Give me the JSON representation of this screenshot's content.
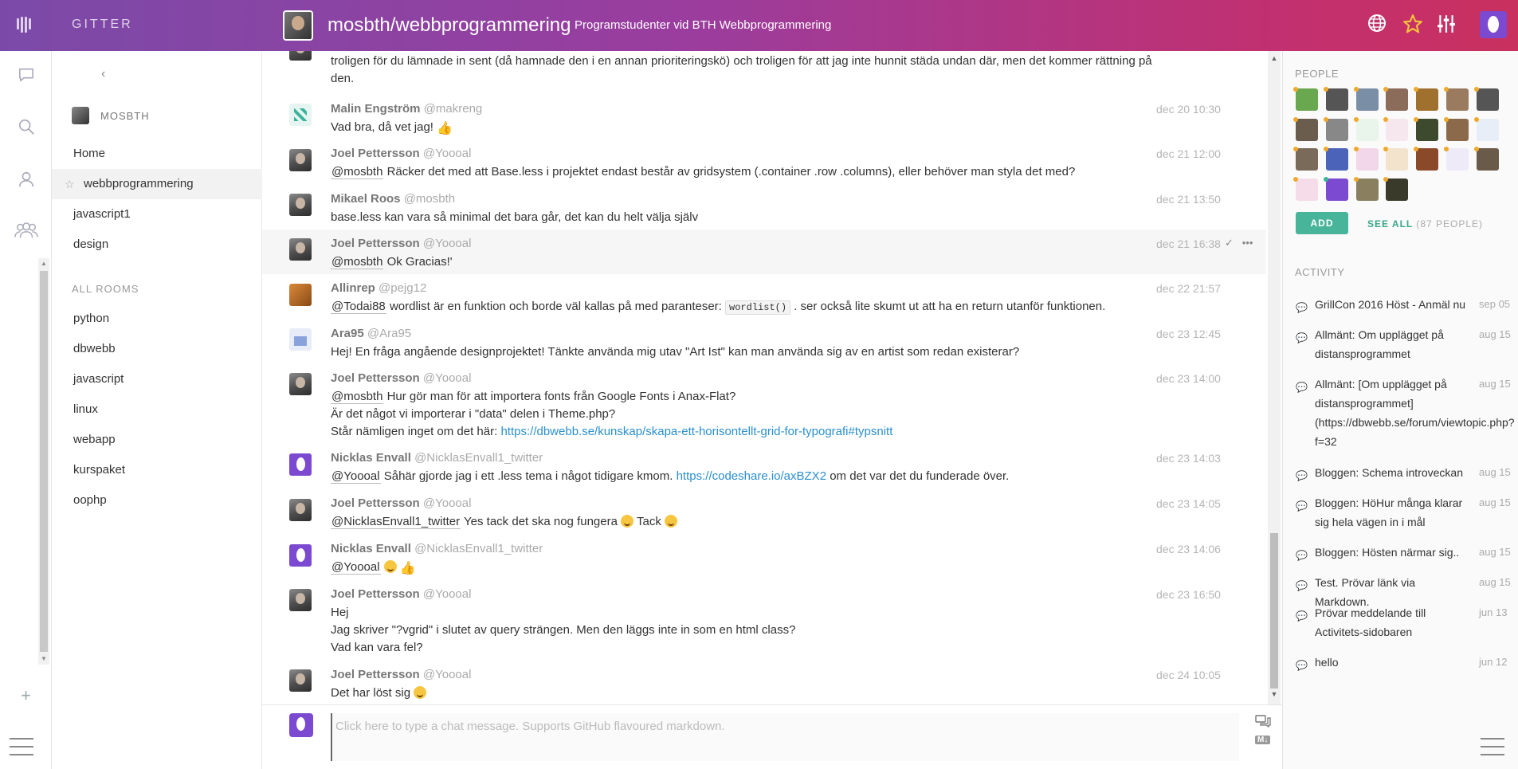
{
  "app": {
    "brand": "GITTER"
  },
  "header": {
    "room_title": "mosbth/webbprogrammering",
    "room_topic": "Programstudenter vid BTH Webbprogrammering",
    "icons": [
      "globe-icon",
      "star-icon",
      "settings-sliders-icon"
    ]
  },
  "roomlist": {
    "org_name": "MOSBTH",
    "items": [
      "Home",
      "webbprogrammering",
      "javascript1",
      "design"
    ],
    "all_rooms_label": "ALL ROOMS",
    "all_rooms": [
      "python",
      "dbwebb",
      "javascript",
      "linux",
      "webapp",
      "kurspaket",
      "oophp"
    ]
  },
  "messages": [
    {
      "name": "",
      "handle": "",
      "time": "",
      "text": "troligen för du lämnade in sent (då hamnade den i en annan prioriteringskö) och troligen för att jag inte hunnit städa undan där, men det kommer rättning på den."
    },
    {
      "name": "Malin Engström",
      "handle": "@makreng",
      "time": "dec 20 10:30",
      "text": "Vad bra, då vet jag!"
    },
    {
      "name": "Joel Pettersson",
      "handle": "@Yoooal",
      "time": "dec 21 12:00",
      "mention": "@mosbth",
      "text": "Räcker det med att Base.less i projektet endast består av gridsystem (.container .row .columns), eller behöver man styla det med?"
    },
    {
      "name": "Mikael Roos",
      "handle": "@mosbth",
      "time": "dec 21 13:50",
      "text": "base.less kan vara så minimal det bara går, det kan du helt välja själv"
    },
    {
      "name": "Joel Pettersson",
      "handle": "@Yoooal",
      "time": "dec 21 16:38",
      "mention": "@mosbth",
      "text": "Ok Gracias!'"
    },
    {
      "name": "Allinrep",
      "handle": "@pejg12",
      "time": "dec 22 21:57",
      "mention": "@Todai88",
      "text_a": "wordlist är en funktion och borde väl kallas på med paranteser:",
      "code": "wordlist()",
      "text_b": ". ser också lite skumt ut att ha en return utanför funktionen."
    },
    {
      "name": "Ara95",
      "handle": "@Ara95",
      "time": "dec 23 12:45",
      "text": "Hej! En fråga angående designprojektet! Tänkte använda mig utav \"Art Ist\" kan man använda sig av en artist som redan existerar?"
    },
    {
      "name": "Joel Pettersson",
      "handle": "@Yoooal",
      "time": "dec 23 14:00",
      "mention": "@mosbth",
      "line1": "Hur gör man för att importera fonts från Google Fonts i Anax-Flat?",
      "line2": "Är det något vi importerar i \"data\" delen i Theme.php?",
      "line3": "Står nämligen inget om det här:",
      "link": "https://dbwebb.se/kunskap/skapa-ett-horisontellt-grid-for-typografi#typsnitt"
    },
    {
      "name": "Nicklas Envall",
      "handle": "@NicklasEnvall1_twitter",
      "time": "dec 23 14:03",
      "mention": "@Yoooal",
      "text_a": "Såhär gjorde jag i ett .less tema i något tidigare kmom.",
      "link": "https://codeshare.io/axBZX2",
      "text_b": "om det var det du funderade över."
    },
    {
      "name": "Joel Pettersson",
      "handle": "@Yoooal",
      "time": "dec 23 14:05",
      "mention": "@NicklasEnvall1_twitter",
      "text_a": "Yes tack det ska nog fungera",
      "text_b": "Tack"
    },
    {
      "name": "Nicklas Envall",
      "handle": "@NicklasEnvall1_twitter",
      "time": "dec 23 14:06",
      "mention": "@Yoooal"
    },
    {
      "name": "Joel Pettersson",
      "handle": "@Yoooal",
      "time": "dec 23 16:50",
      "line1": "Hej",
      "line2": "Jag skriver \"?vgrid\" i slutet av query strängen. Men den läggs inte in som en html class?",
      "line3": "Vad kan vara fel?"
    },
    {
      "name": "Joel Pettersson",
      "handle": "@Yoooal",
      "time": "dec 24 10:05",
      "text": "Det har löst sig"
    }
  ],
  "composer": {
    "placeholder": "Click here to type a chat message. Supports GitHub flavoured markdown.",
    "md_badge": "M↓"
  },
  "people": {
    "title": "PEOPLE",
    "add_label": "ADD",
    "see_all_label": "SEE ALL",
    "count_label": "(87 PEOPLE)"
  },
  "activity": {
    "title": "ACTIVITY",
    "items": [
      {
        "text": "GrillCon 2016 Höst - Anmäl nu",
        "date": "sep 05"
      },
      {
        "text": "Allmänt: Om upplägget på distansprogrammet",
        "date": "aug 15"
      },
      {
        "text": "Allmänt: [Om upplägget på distansprogrammet](https://dbwebb.se/forum/viewtopic.php?f=32",
        "date": "aug 15"
      },
      {
        "text": "Bloggen: Schema introveckan",
        "date": "aug 15"
      },
      {
        "text": "Bloggen: HöHur många klarar sig hela vägen in i mål",
        "date": "aug 15"
      },
      {
        "text": "Bloggen: Hösten närmar sig..",
        "date": "aug 15"
      },
      {
        "text": "Test. Prövar länk via Markdown.",
        "date": "aug 15"
      },
      {
        "text": "Prövar meddelande till Activitets-sidobaren",
        "date": "jun 13"
      },
      {
        "text": "hello",
        "date": "jun 12"
      }
    ]
  }
}
